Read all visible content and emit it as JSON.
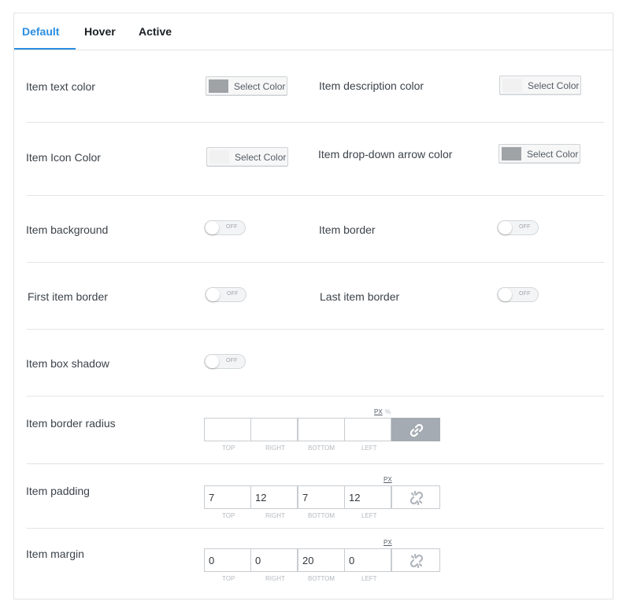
{
  "tabs": [
    {
      "label": "Default",
      "active": true
    },
    {
      "label": "Hover",
      "active": false
    },
    {
      "label": "Active",
      "active": false
    }
  ],
  "colors": {
    "accent": "#2b8ee0",
    "swatch_set": "#a0a3a6",
    "swatch_empty": "#f1f1f1"
  },
  "color_settings": {
    "text_color": {
      "label": "Item text color",
      "button": "Select Color",
      "swatch": "#a0a3a6"
    },
    "description_color": {
      "label": "Item description color",
      "button": "Select Color",
      "swatch": "#f1f1f1"
    },
    "icon_color": {
      "label": "Item Icon Color",
      "button": "Select Color",
      "swatch": "#f1f1f1"
    },
    "arrow_color": {
      "label": "Item drop-down arrow color",
      "button": "Select Color",
      "swatch": "#a0a3a6"
    }
  },
  "toggles": {
    "background": {
      "label": "Item background",
      "state": "OFF"
    },
    "border": {
      "label": "Item border",
      "state": "OFF"
    },
    "first_border": {
      "label": "First item border",
      "state": "OFF"
    },
    "last_border": {
      "label": "Last item border",
      "state": "OFF"
    },
    "box_shadow": {
      "label": "Item box shadow",
      "state": "OFF"
    }
  },
  "dimensions": {
    "captions": {
      "top": "TOP",
      "right": "RIGHT",
      "bottom": "BOTTOM",
      "left": "LEFT"
    },
    "border_radius": {
      "label": "Item border radius",
      "units": [
        "PX",
        "%"
      ],
      "top": "",
      "right": "",
      "bottom": "",
      "left": "",
      "linked": true
    },
    "padding": {
      "label": "Item padding",
      "units": [
        "PX"
      ],
      "top": "7",
      "right": "12",
      "bottom": "7",
      "left": "12",
      "linked": false
    },
    "margin": {
      "label": "Item margin",
      "units": [
        "PX"
      ],
      "top": "0",
      "right": "0",
      "bottom": "20",
      "left": "0",
      "linked": false
    }
  }
}
